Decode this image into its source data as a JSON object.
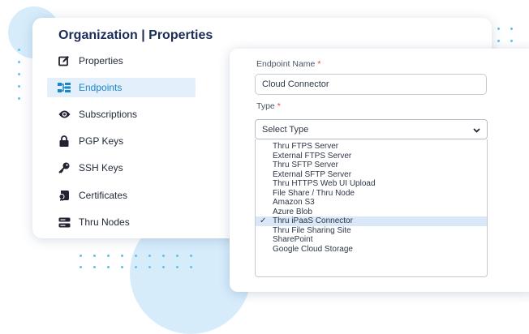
{
  "card": {
    "title": "Organization | Properties"
  },
  "sidebar": {
    "items": [
      {
        "label": "Properties",
        "icon": "edit-icon"
      },
      {
        "label": "Endpoints",
        "icon": "endpoints-icon",
        "active": true
      },
      {
        "label": "Subscriptions",
        "icon": "eye-icon"
      },
      {
        "label": "PGP Keys",
        "icon": "lock-icon"
      },
      {
        "label": "SSH Keys",
        "icon": "key-icon"
      },
      {
        "label": "Certificates",
        "icon": "certificate-icon"
      },
      {
        "label": "Thru Nodes",
        "icon": "server-icon"
      }
    ]
  },
  "form": {
    "endpoint_name": {
      "label": "Endpoint Name",
      "required_mark": "*",
      "value": "Cloud Connector"
    },
    "type": {
      "label": "Type",
      "required_mark": "*",
      "selected_text": "Select Type",
      "options": [
        "Thru FTPS Server",
        "External FTPS Server",
        "Thru SFTP Server",
        "External SFTP Server",
        "Thru HTTPS Web UI Upload",
        "File Share / Thru Node",
        "Amazon S3",
        "Azure Blob",
        "Thru iPaaS Connector",
        "Thru File Sharing Site",
        "SharePoint",
        "Google Cloud Storage"
      ],
      "checked_option": "Thru iPaaS Connector",
      "check_glyph": "✓"
    }
  },
  "colors": {
    "accent": "#1b86c7",
    "active_bg": "#e3effa",
    "title": "#1b2c57",
    "decor_blob": "#d6ecfb",
    "decor_dots": "#5cc3ef"
  }
}
